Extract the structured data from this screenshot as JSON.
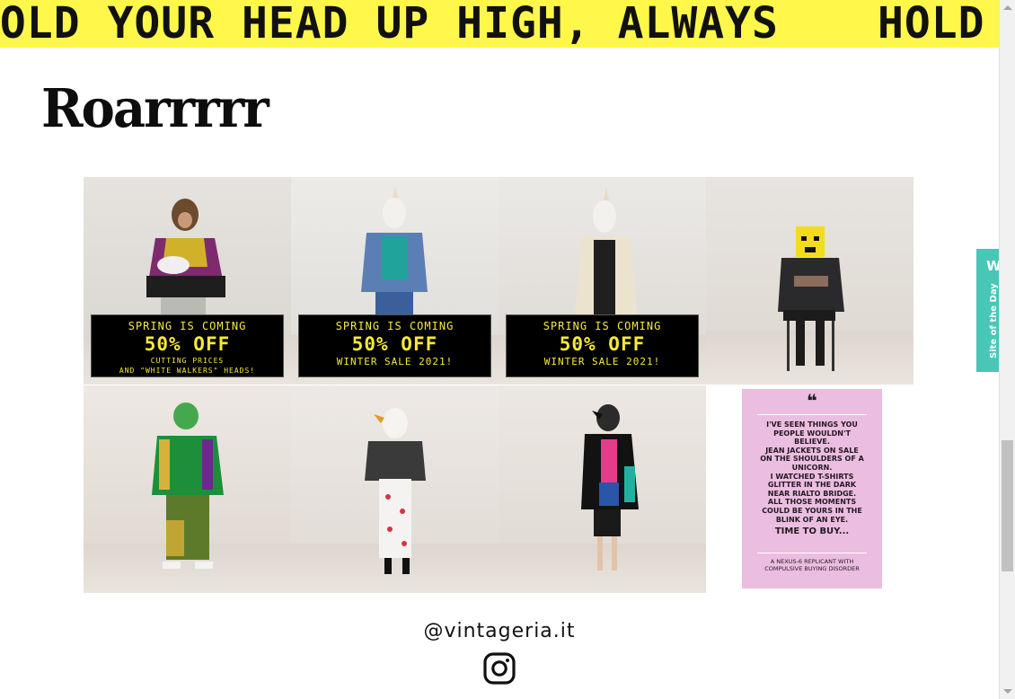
{
  "marquee": {
    "text": "HOLD YOUR HEAD UP HIGH, ALWAYS"
  },
  "title": "Roarrrrr",
  "tiles": [
    {
      "promo": {
        "line1": "SPRING IS COMING",
        "line2": "50% OFF",
        "line3": "CUTTING PRICES",
        "line4": "AND \"WHITE WALKERS\" HEADS!"
      }
    },
    {
      "promo": {
        "line1": "SPRING IS COMING",
        "line2": "50% OFF",
        "line3": "WINTER SALE 2021!"
      }
    },
    {
      "promo": {
        "line1": "SPRING IS COMING",
        "line2": "50% OFF",
        "line3": "WINTER SALE 2021!"
      }
    }
  ],
  "quote": {
    "mark": "❝",
    "body": [
      "I'VE SEEN THINGS YOU",
      "PEOPLE WOULDN'T",
      "BELIEVE.",
      "JEAN JACKETS ON SALE",
      "ON THE SHOULDERS OF A",
      "UNICORN.",
      "I WATCHED T-SHIRTS",
      "GLITTER IN THE DARK",
      "NEAR RIALTO BRIDGE.",
      "ALL THOSE MOMENTS",
      "COULD BE YOURS IN THE",
      "BLINK OF AN EYE."
    ],
    "cta": "TIME TO BUY...",
    "signature": [
      "A NEXUS-6 REPLICANT WITH",
      "COMPULSIVE BUYING DISORDER"
    ]
  },
  "footer": {
    "handle": "@vintageria.it",
    "social_icon": "instagram-icon"
  },
  "badge": {
    "logo": "W.",
    "label": "Site of the Day",
    "color": "#48c7b6"
  },
  "colors": {
    "marquee_bg": "#fff84a",
    "promo_text": "#f7e93a",
    "quote_bg": "#ebbde0"
  }
}
